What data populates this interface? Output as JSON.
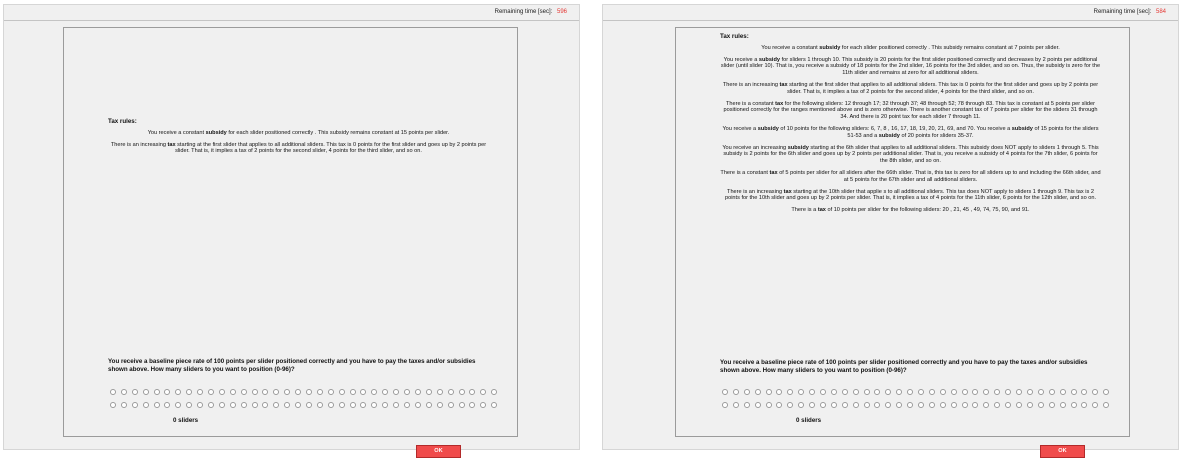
{
  "common": {
    "timer_label": "Remaining time [sec]:",
    "rules_title": "Tax rules:",
    "question": "You receive a baseline piece rate of 100 points per slider positioned correctly and you have to pay the taxes and/or subsidies shown above. How many sliders to you want to position (0-96)?",
    "slider_count": "0 sliders",
    "ok_label": "OK"
  },
  "left": {
    "timer_value": "596",
    "rules": [
      [
        "You receive a constant ",
        {
          "b": "subsidy"
        },
        " for each slider positioned correctly . This subsidy remains constant at 15 points per slider."
      ],
      [
        "There is an increasing ",
        {
          "b": "tax"
        },
        " starting at the first slider that applies to all additional sliders. This tax is 0 points for the first slider and goes up by 2 points per  slider. That is, it implies a tax of 2 points for the second slider, 4 points for the third slider, and so on."
      ]
    ]
  },
  "right": {
    "timer_value": "584",
    "rules": [
      [
        "You receive a constant ",
        {
          "b": "subsidy"
        },
        " for each slider positioned correctly . This subsidy remains constant at 7 points per slider."
      ],
      [
        "You receive a ",
        {
          "b": "subsidy"
        },
        " for sliders 1 through 10. This subsidy is 20  points for the first slider positioned correctly and decreases by 2 points per additional slider (until slider 10). That is, you receive a subsidy of 18 points for the 2nd slider, 16 points for the 3rd slider, and so on. Thus, the subsidy is zero for the 11th slider and remains at zero for all additional sliders."
      ],
      [
        "There is an increasing ",
        {
          "b": "tax"
        },
        " starting at the first slider that applies to all additional sliders. This tax is 0 points for the first slider and goes up by 2 points per  slider. That is, it implies a tax of 2 points for the second slider, 4 points for the third slider, and so on."
      ],
      [
        "There is a constant ",
        {
          "b": "tax"
        },
        " for the following sliders: 12 through 17; 32  through 37; 48 through 52; 78 through 83. This tax is constant at 5 points per slider positioned correctly for the ranges mentioned above and is zero otherwise. There is another constant tax of 7 points per slider for the sliders 31 through 34. And there is 20 point tax for each slider 7 through 11."
      ],
      [
        "You receive a ",
        {
          "b": "subsidy"
        },
        " of 10 points for the following sliders: 6, 7, 8 , 16, 17, 18, 19, 20, 21, 69, and 70. You receive a ",
        {
          "b": "subsidy"
        },
        " of 15 points for the sliders 51-53 and a ",
        {
          "b": "subsidy"
        },
        " of 20 points for sliders 35-37."
      ],
      [
        "You receive an increasing ",
        {
          "b": "subsidy"
        },
        " starting at the 6th slider  that applies to all additional sliders. This subsidy does NOT apply to sliders 1 through 5. This subsidy is 2 points for the 6th slider and goes up by 2 points per additional slider. That is, you receive a subsidy of 4 points for the 7th slider, 6 points for the 8th slider, and so on."
      ],
      [
        "There is a constant ",
        {
          "b": "tax"
        },
        " of 5 points per slider for all sliders after  the 66th slider. That is, this tax is zero for all sliders up to and including the 66th slider, and at 5 points for the 67th slider and all additional sliders."
      ],
      [
        "There is an increasing ",
        {
          "b": "tax"
        },
        " starting at the 10th slider that applie s to all additional sliders. This tax does NOT apply to sliders 1 through 9. This tax is 2 points for the 10th slider and goes up by 2 points per slider. That is, it implies a tax of 4 points for the 11th slider, 6 points for the 12th slider, and so on."
      ],
      [
        "There is a ",
        {
          "b": "tax"
        },
        " of 10 points per slider for the following sliders: 20 , 21, 45 , 49, 74, 75, 90, and 91."
      ]
    ]
  },
  "radio_rows": [
    36,
    36
  ]
}
